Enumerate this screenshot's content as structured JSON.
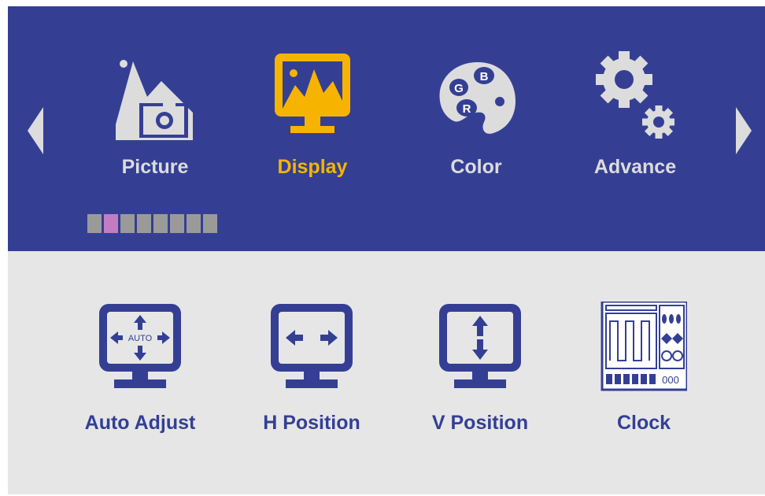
{
  "colors": {
    "panel_top": "#343f94",
    "panel_bottom": "#e6e6e6",
    "selected": "#f6b400",
    "unselected": "#dcdcdc",
    "item_text": "#343f94",
    "page_dot": "#9a9a9a",
    "page_dot_active": "#c47cc0"
  },
  "nav": {
    "left_arrow_icon": "chevron-left-icon",
    "right_arrow_icon": "chevron-right-icon"
  },
  "tabs": [
    {
      "label": "Picture",
      "icon": "picture-icon",
      "selected": false
    },
    {
      "label": "Display",
      "icon": "display-icon",
      "selected": true
    },
    {
      "label": "Color",
      "icon": "palette-icon",
      "selected": false
    },
    {
      "label": "Advance",
      "icon": "gears-icon",
      "selected": false
    }
  ],
  "palette_letters": {
    "g": "G",
    "b": "B",
    "r": "R"
  },
  "page_indicator": {
    "total": 8,
    "active_index": 1
  },
  "items": [
    {
      "label": "Auto Adjust",
      "icon": "auto-adjust-icon",
      "badge": "AUTO"
    },
    {
      "label": "H Position",
      "icon": "h-position-icon"
    },
    {
      "label": "V Position",
      "icon": "v-position-icon"
    },
    {
      "label": "Clock",
      "icon": "clock-icon",
      "badge": "000"
    }
  ]
}
